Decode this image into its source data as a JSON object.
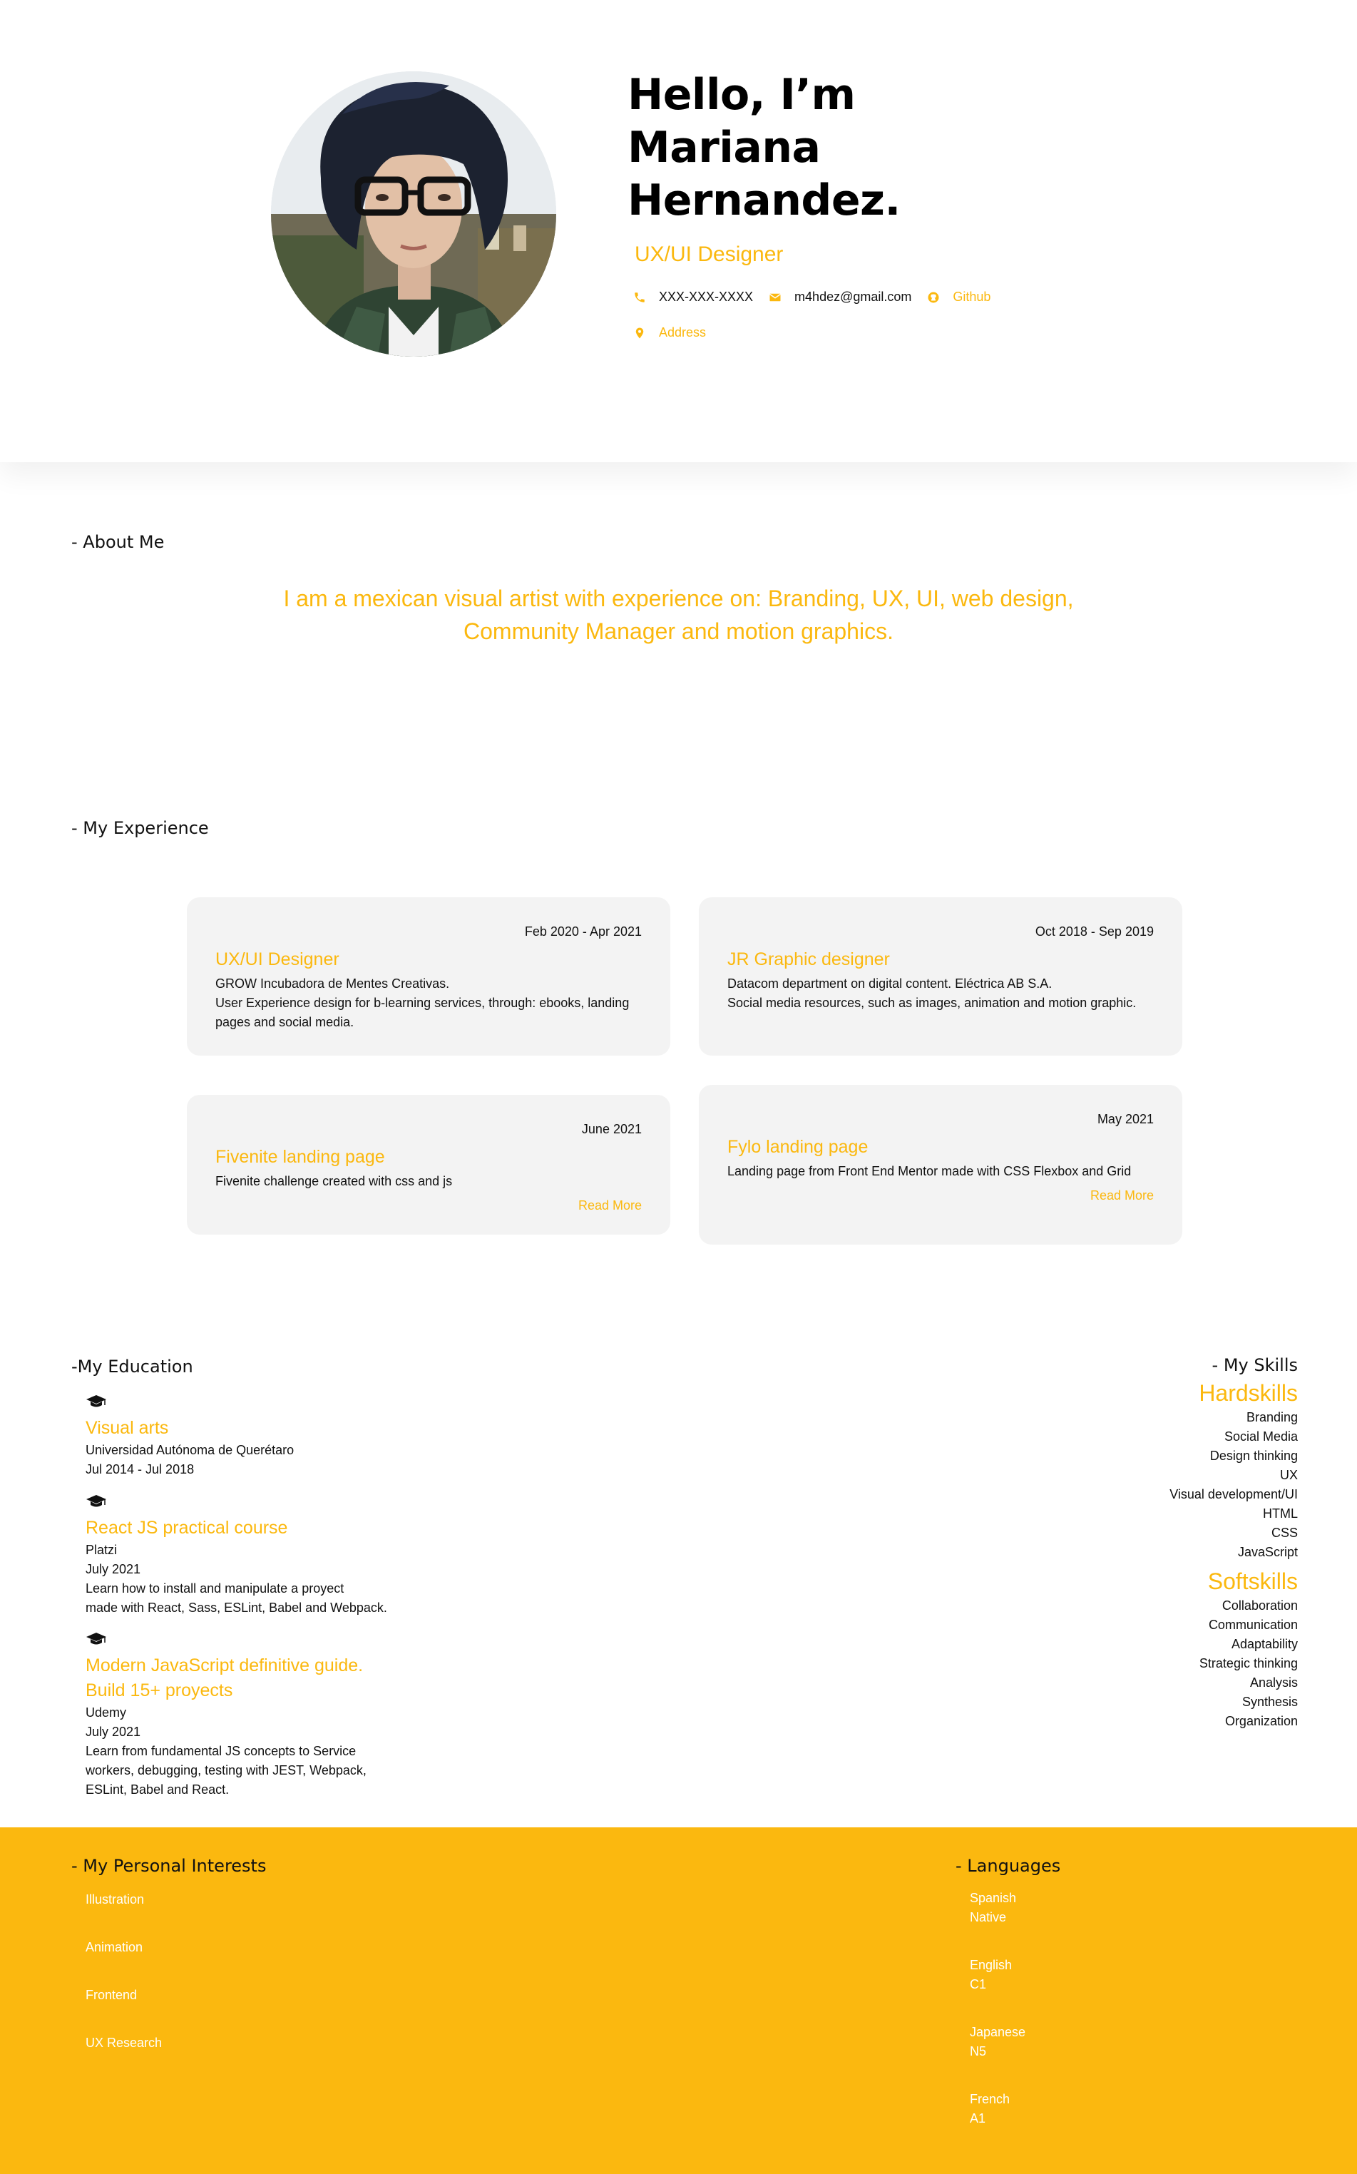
{
  "header": {
    "greeting_lines": [
      "Hello, I’m",
      "Mariana",
      "Hernandez."
    ],
    "role": "UX/UI Designer",
    "contacts": {
      "phone": "XXX-XXX-XXXX",
      "email": "m4hdez@gmail.com",
      "github": "Github",
      "address": "Address"
    },
    "accent_color": "#fbb80f"
  },
  "about": {
    "title": "- About Me",
    "text": "I am a mexican visual artist with experience on: Branding, UX, UI, web design, Community Manager and motion graphics."
  },
  "experience": {
    "title": "- My Experience",
    "cards": [
      {
        "date": "Feb 2020 - Apr 2021",
        "title": "UX/UI Designer",
        "lines": [
          "GROW Incubadora de Mentes Creativas.",
          "User Experience design for b-learning services, through: ebooks, landing pages and social media."
        ]
      },
      {
        "date": "Oct 2018 - Sep 2019",
        "title": "JR Graphic designer",
        "lines": [
          "Datacom department on digital content. Eléctrica AB S.A.",
          "Social media resources, such as images, animation and motion graphic."
        ]
      },
      {
        "date": "June 2021",
        "title": "Fivenite landing page",
        "lines": [
          "Fivenite challenge created with css and js"
        ],
        "more": "Read More"
      },
      {
        "date": "May 2021",
        "title": "Fylo landing page",
        "lines": [
          "Landing page from Front End Mentor made with CSS Flexbox and Grid"
        ],
        "more": "Read More"
      }
    ]
  },
  "education": {
    "title": "-My Education",
    "items": [
      {
        "title_lines": [
          "Visual arts"
        ],
        "lines": [
          "Universidad Autónoma de Querétaro",
          "Jul 2014 - Jul 2018"
        ]
      },
      {
        "title_lines": [
          "React JS practical course"
        ],
        "lines": [
          "Platzi",
          "July 2021",
          "Learn how to install and manipulate a proyect",
          "made with React, Sass, ESLint, Babel and Webpack."
        ]
      },
      {
        "title_lines": [
          "Modern JavaScript definitive guide.",
          "Build 15+ proyects"
        ],
        "lines": [
          "Udemy",
          "July 2021",
          "Learn from fundamental JS concepts to Service",
          "workers, debugging, testing with JEST, Webpack,",
          "ESLint, Babel and React."
        ]
      }
    ]
  },
  "skills": {
    "title": "- My Skills",
    "hard_title": "Hardskills",
    "hard": [
      "Branding",
      "Social Media",
      "Design thinking",
      "UX",
      "Visual development/UI",
      "HTML",
      "CSS",
      "JavaScript"
    ],
    "soft_title": "Softskills",
    "soft": [
      "Collaboration",
      "Communication",
      "Adaptability",
      "Strategic thinking",
      "Analysis",
      "Synthesis",
      "Organization"
    ]
  },
  "interests": {
    "title": "- My Personal Interests",
    "items": [
      "Illustration",
      "Animation",
      "Frontend",
      "UX Research"
    ]
  },
  "languages": {
    "title": "- Languages",
    "items": [
      {
        "name": "Spanish",
        "level": "Native"
      },
      {
        "name": "English",
        "level": "C1"
      },
      {
        "name": "Japanese",
        "level": "N5"
      },
      {
        "name": "French",
        "level": "A1"
      }
    ]
  },
  "icons": {
    "phone": "phone-icon",
    "email": "email-icon",
    "github": "github-icon",
    "address": "map-pin-icon",
    "education": "graduation-cap-icon"
  }
}
